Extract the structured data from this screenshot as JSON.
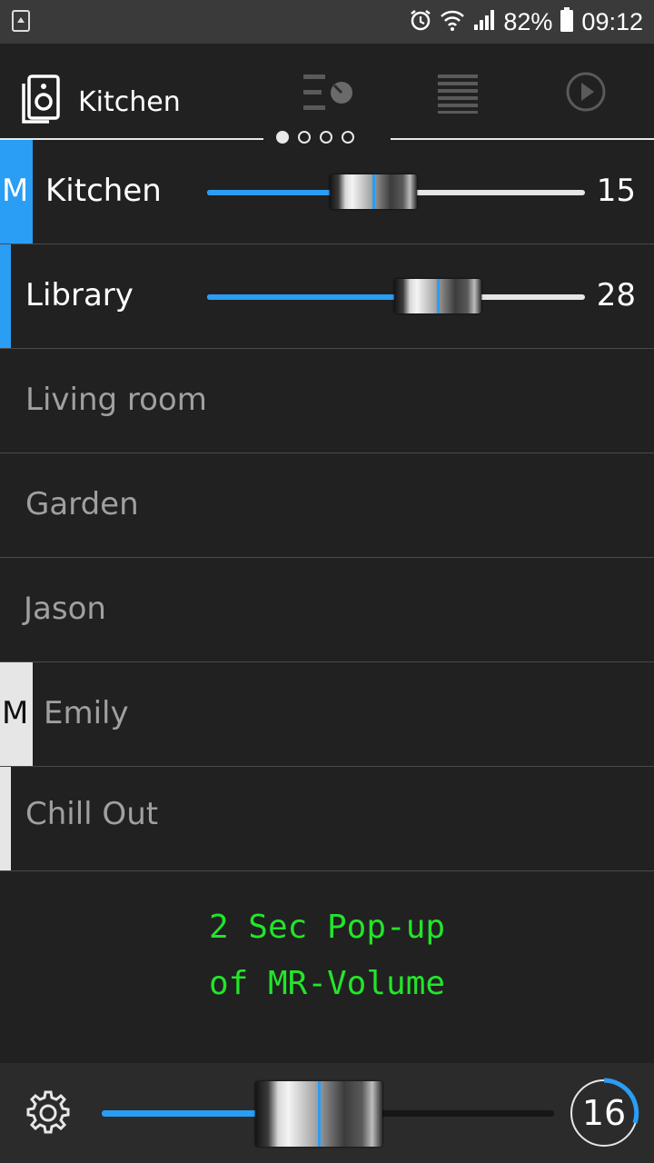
{
  "status_bar": {
    "left_icon": "recycle-notification-icon",
    "icons": [
      "alarm-icon",
      "wifi-icon",
      "signal-icon"
    ],
    "battery": "82%",
    "time": "09:12"
  },
  "header": {
    "zone_icon": "speaker-icon",
    "zone_name": "Kitchen",
    "tab_icons": [
      "equalizer-knob-icon",
      "queue-list-icon",
      "play-circle-icon"
    ],
    "page_count": 4,
    "active_page": 0
  },
  "rooms": [
    {
      "name": "Kitchen",
      "marker": "M",
      "state": "active",
      "volume": "15",
      "level": 0.44
    },
    {
      "name": "Library",
      "marker": "",
      "state": "active",
      "volume": "28",
      "level": 0.61
    },
    {
      "name": "Living room",
      "marker": "",
      "state": "inactive"
    },
    {
      "name": "Garden",
      "marker": "",
      "state": "inactive"
    },
    {
      "name": "Jason",
      "marker": "",
      "state": "inactive"
    },
    {
      "name": "Emily",
      "marker": "M",
      "state": "inactive"
    },
    {
      "name": "Chill Out",
      "marker": "",
      "state": "inactive"
    }
  ],
  "popup": {
    "line1": "2 Sec Pop-up",
    "line2": "of MR-Volume"
  },
  "footer": {
    "settings_icon": "gear-icon",
    "master_volume": "16",
    "master_level": 0.48
  },
  "colors": {
    "accent": "#2a9df4",
    "popup_text": "#22e52a",
    "marker_inactive": "#e6e6e6",
    "background": "#212121"
  }
}
